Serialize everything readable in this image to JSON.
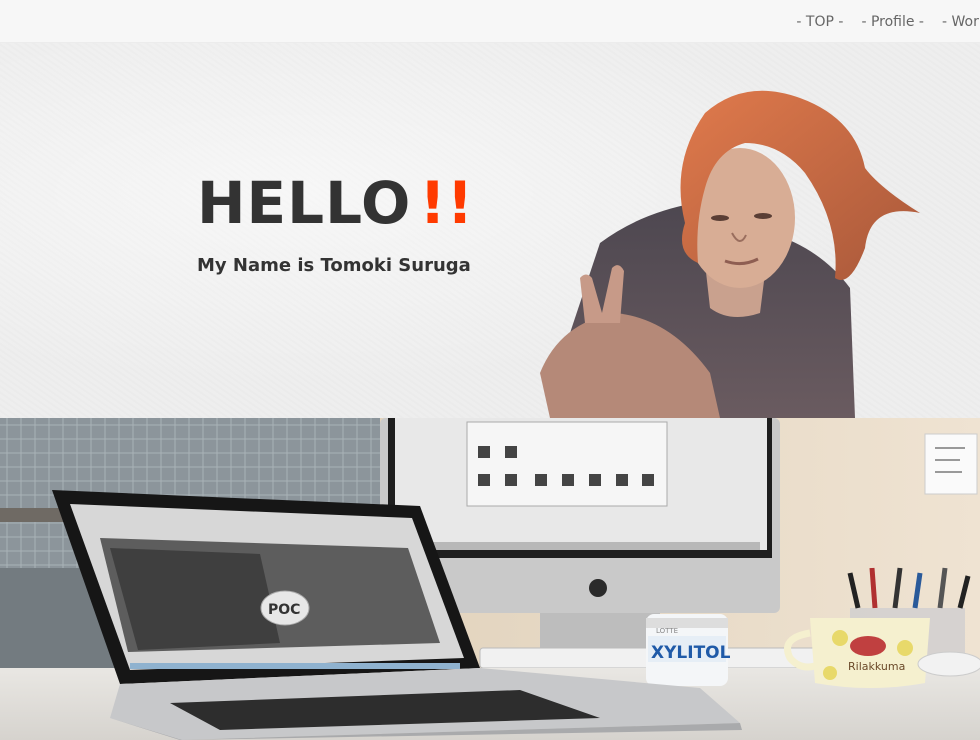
{
  "nav": {
    "items": [
      {
        "label": "- TOP -"
      },
      {
        "label": "- Profile -"
      },
      {
        "label": "- Works -"
      }
    ]
  },
  "hero": {
    "greeting": "HELLO",
    "exclaim": "!!",
    "subtitle": "My Name is Tomoki Suruga",
    "accent_color": "#ff3a00",
    "text_color": "#333333"
  },
  "photo": {
    "laptop_screen_text": "POC",
    "mug_text": "Rilakkuma",
    "gum_brand": "XYLITOL",
    "gum_maker": "LOTTE"
  }
}
